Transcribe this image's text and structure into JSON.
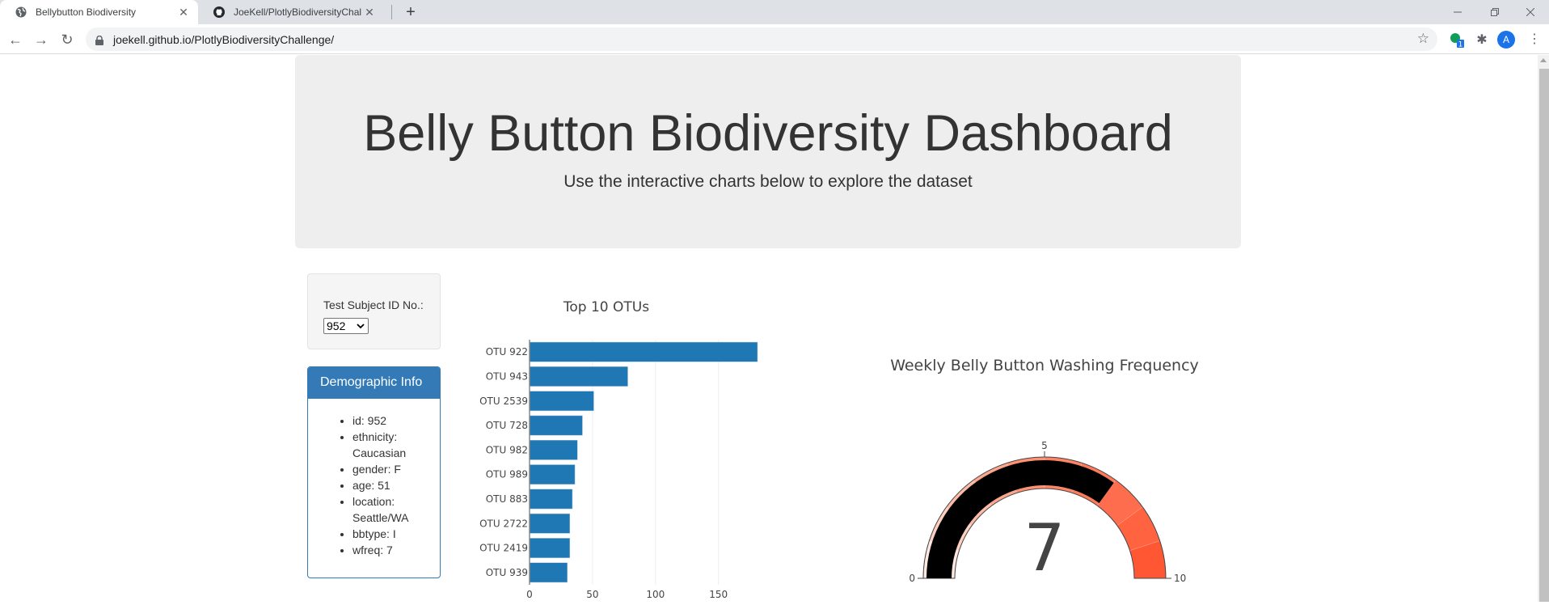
{
  "browser": {
    "tabs": [
      {
        "title": "Bellybutton Biodiversity",
        "icon": "globe-icon",
        "active": true
      },
      {
        "title": "JoeKell/PlotlyBiodiversityChallenge",
        "icon": "github-icon",
        "active": false
      }
    ],
    "new_tab_label": "+",
    "url": "joekell.github.io/PlotlyBiodiversityChallenge/",
    "extension_badge": "1",
    "profile_initial": "A"
  },
  "header": {
    "title": "Belly Button Biodiversity Dashboard",
    "subtitle": "Use the interactive charts below to explore the dataset"
  },
  "selector": {
    "label": "Test Subject ID No.:",
    "selected": "952"
  },
  "demographics": {
    "heading": "Demographic Info",
    "items": [
      "id: 952",
      "ethnicity: Caucasian",
      "gender: F",
      "age: 51",
      "location: Seattle/WA",
      "bbtype: I",
      "wfreq: 7"
    ]
  },
  "chart_data": [
    {
      "type": "bar",
      "orientation": "horizontal",
      "title": "Top 10 OTUs",
      "categories": [
        "OTU 922",
        "OTU 943",
        "OTU 2539",
        "OTU 728",
        "OTU 982",
        "OTU 989",
        "OTU 883",
        "OTU 2722",
        "OTU 2419",
        "OTU 939"
      ],
      "values": [
        181,
        78,
        51,
        42,
        38,
        36,
        34,
        32,
        32,
        30
      ],
      "xlabel": "",
      "ylabel": "",
      "xlim": [
        0,
        190
      ],
      "xticks": [
        0,
        50,
        100,
        150
      ],
      "grid": true,
      "color": "#1f77b4"
    },
    {
      "type": "gauge",
      "title": "Weekly Belly Button Washing Frequency",
      "value": 7,
      "range": [
        0,
        10
      ],
      "tick_labels": [
        "0",
        "5",
        "10"
      ],
      "bar_color": "#000000",
      "steps": [
        {
          "range": [
            0,
            1
          ],
          "color": "#fee8e1"
        },
        {
          "range": [
            1,
            2
          ],
          "color": "#fdd0c2"
        },
        {
          "range": [
            2,
            3
          ],
          "color": "#fcbba5"
        },
        {
          "range": [
            3,
            4
          ],
          "color": "#fca68b"
        },
        {
          "range": [
            4,
            5
          ],
          "color": "#fc9272"
        },
        {
          "range": [
            5,
            6
          ],
          "color": "#fc8566"
        },
        {
          "range": [
            6,
            7
          ],
          "color": "#fd7a5a"
        },
        {
          "range": [
            7,
            8
          ],
          "color": "#fe6d4d"
        },
        {
          "range": [
            8,
            9
          ],
          "color": "#ff6340"
        },
        {
          "range": [
            9,
            10
          ],
          "color": "#ff5733"
        }
      ]
    }
  ]
}
